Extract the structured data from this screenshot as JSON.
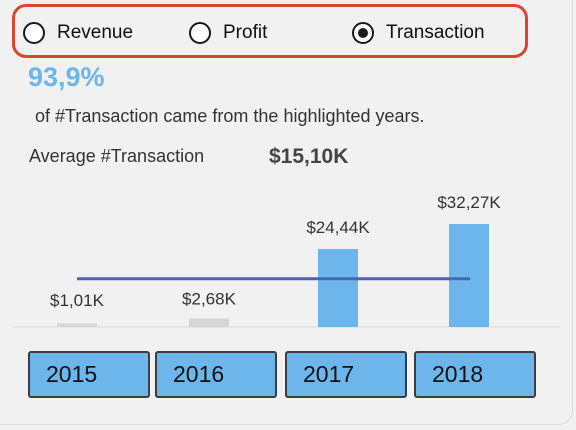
{
  "metric_selector": {
    "options": [
      {
        "label": "Revenue",
        "selected": false
      },
      {
        "label": "Profit",
        "selected": false
      },
      {
        "label": "Transaction",
        "selected": true
      }
    ]
  },
  "summary": {
    "share_pct": "93,9%",
    "share_text": "of #Transaction came from the highlighted years.",
    "avg_label": "Average #Transaction",
    "avg_value": "$15,10K"
  },
  "colors": {
    "highlight_bar": "#6cb6ec",
    "dim_bar": "#d6d6d6",
    "average_line": "#4a63b3",
    "selector_border": "#d9452f"
  },
  "year_buttons": [
    "2015",
    "2016",
    "2017",
    "2018"
  ],
  "chart_data": {
    "type": "bar",
    "categories": [
      "2015",
      "2016",
      "2017",
      "2018"
    ],
    "values": [
      1.01,
      2.68,
      24.44,
      32.27
    ],
    "data_labels": [
      "$1,01K",
      "$2,68K",
      "$24,44K",
      "$32,27K"
    ],
    "highlighted": [
      false,
      false,
      true,
      true
    ],
    "average": 15.1,
    "unit": "K"
  }
}
